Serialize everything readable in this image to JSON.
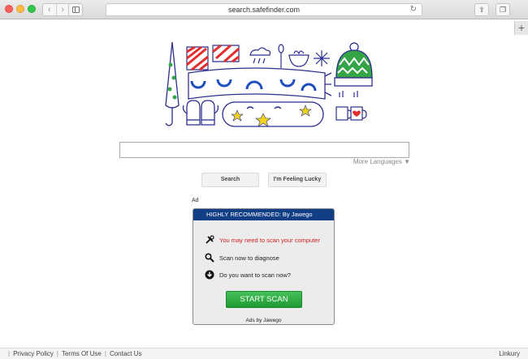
{
  "browser": {
    "url": "search.safefinder.com",
    "back_icon": "chevron-left-icon",
    "forward_icon": "chevron-right-icon",
    "new_tab_label": "+"
  },
  "search": {
    "input_value": "",
    "more_languages": "More Languages ▼",
    "search_button": "Search",
    "lucky_button": "I'm Feeling Lucky"
  },
  "ad": {
    "label": "Ad",
    "header": "HIGHLY RECOMMENDED: By Jawego",
    "rows": [
      {
        "icon": "tools-icon",
        "text": "You may need to scan your computer",
        "color": "#d12020"
      },
      {
        "icon": "magnifier-icon",
        "text": "Scan now to diagnose"
      },
      {
        "icon": "download-circle-icon",
        "text": "Do you want to scan now?"
      }
    ],
    "button": "START SCAN",
    "footer": "Ads by Jawego",
    "header_color": "#123e86",
    "button_color": "#2fae44"
  },
  "footer": {
    "links": [
      "Privacy Policy",
      "Terms Of Use",
      "Contact Us"
    ],
    "brand": "Linkury"
  }
}
